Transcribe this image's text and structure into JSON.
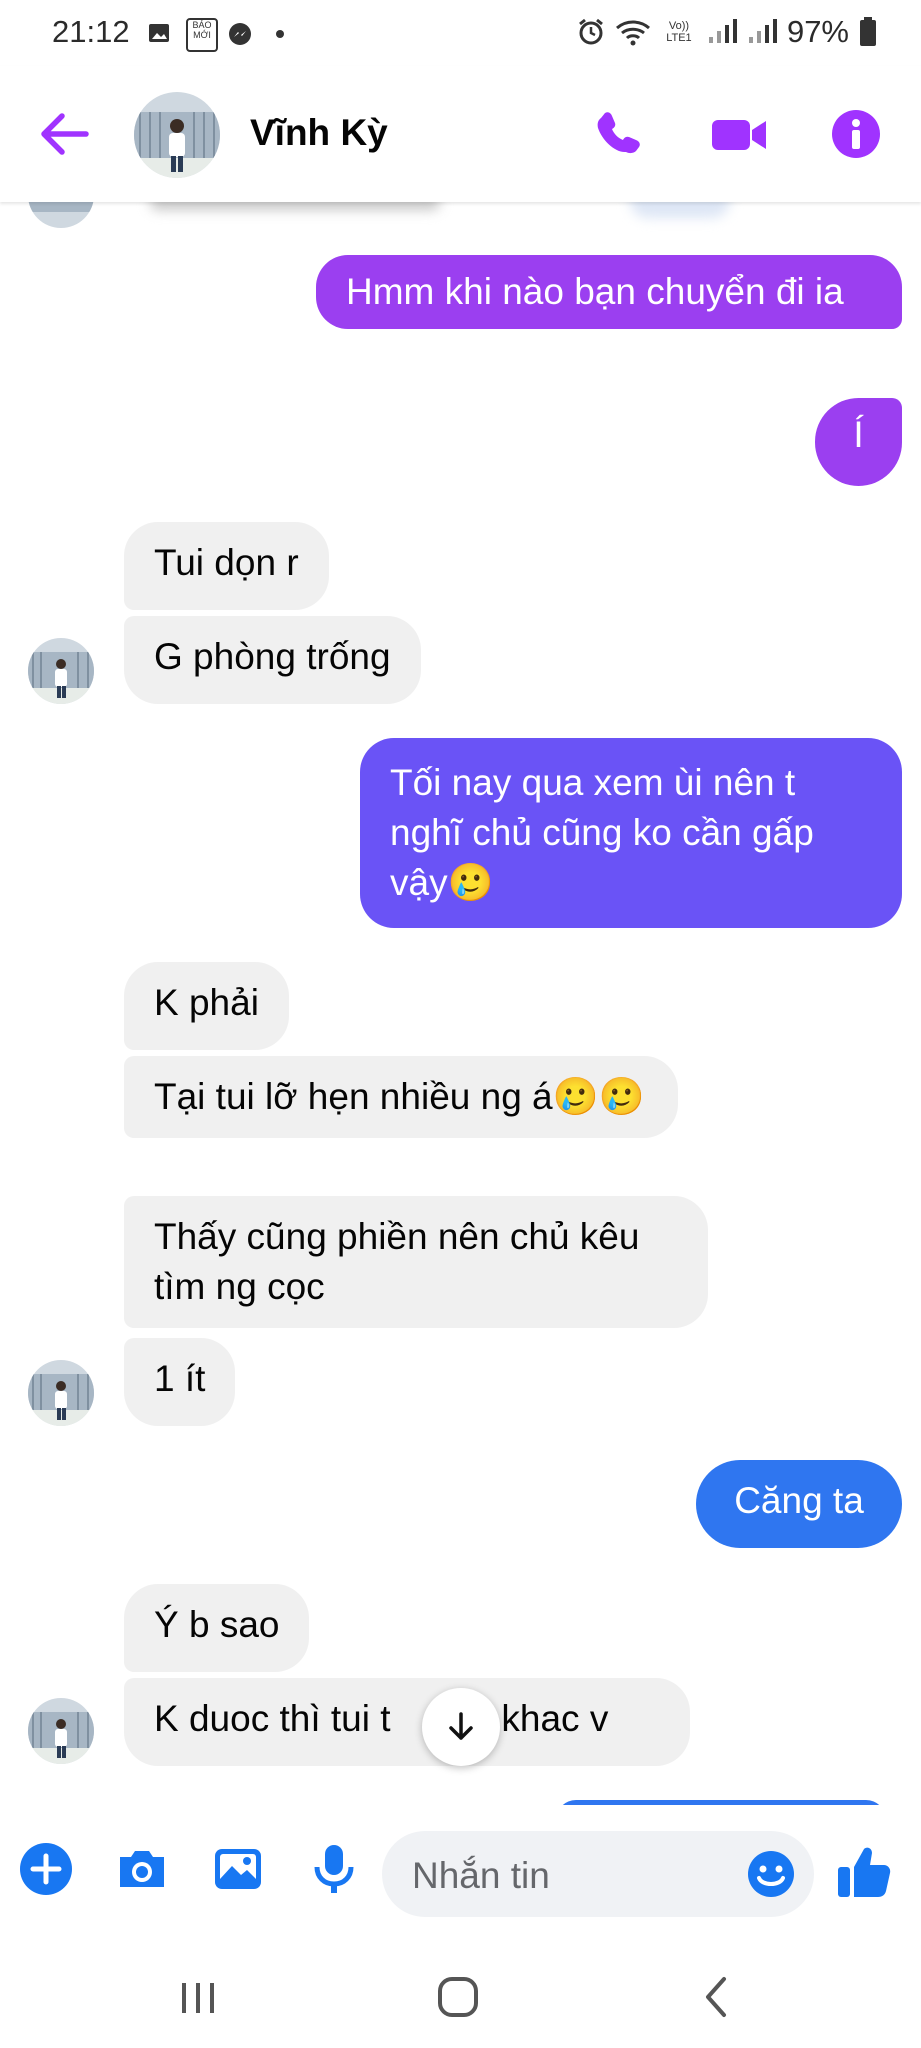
{
  "status_bar": {
    "time": "21:12",
    "battery": "97%",
    "network_label": "Vo)) LTE1"
  },
  "header": {
    "contact_name": "Vĩnh Kỳ",
    "icons": [
      "back-arrow-icon",
      "phone-icon",
      "video-camera-icon",
      "info-icon"
    ]
  },
  "messages": [
    {
      "sender": "me",
      "text": "Hmm khi nào bạn chuyển đi ia"
    },
    {
      "sender": "me",
      "text": "Í"
    },
    {
      "sender": "them",
      "text": "Tui dọn r"
    },
    {
      "sender": "them",
      "text": "G phòng trống"
    },
    {
      "sender": "me",
      "text": "Tối nay qua xem ùi nên t nghĩ chủ cũng ko cần gấp vậy🥲"
    },
    {
      "sender": "them",
      "text": "K phải"
    },
    {
      "sender": "them",
      "text": "Tại tui lỡ hẹn nhiều ng á🥲🥲"
    },
    {
      "sender": "them",
      "text": "Thấy cũng phiền nên chủ kêu tìm ng cọc"
    },
    {
      "sender": "them",
      "text": "1 ít"
    },
    {
      "sender": "me",
      "text": "Căng ta"
    },
    {
      "sender": "them",
      "text": "Ý b sao"
    },
    {
      "sender": "them",
      "text": "K duoc thì tui t",
      "text_after": "g khac v"
    }
  ],
  "composer": {
    "placeholder": "Nhắn tin"
  },
  "colors": {
    "accent_purple": "#a033ff",
    "bubble_purple": "#9b3ff0",
    "bubble_indigo": "#6a53f6",
    "bubble_blue": "#2f76f0",
    "incoming_bubble": "#f0f0f0",
    "composer_blue": "#1877f2"
  }
}
